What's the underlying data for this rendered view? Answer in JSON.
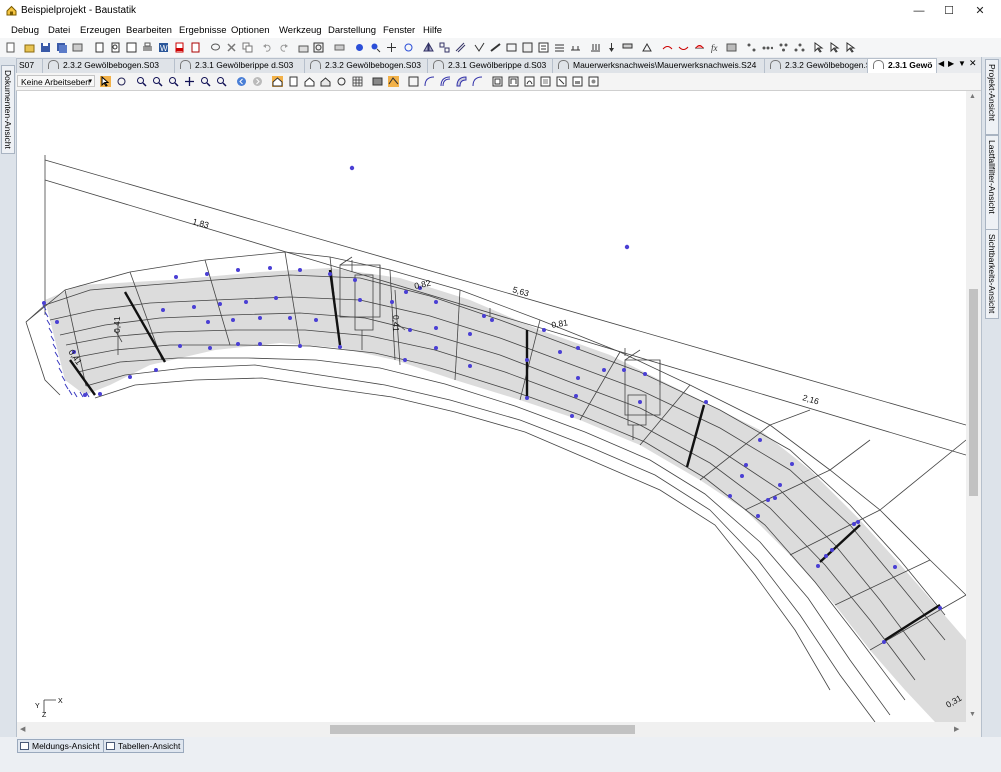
{
  "window": {
    "title": "Beispielprojekt - Baustatik",
    "minimize": "—",
    "maximize": "☐",
    "close": "✕"
  },
  "menu": [
    "Debug",
    "Datei",
    "Erzeugen",
    "Bearbeiten",
    "Ergebnisse",
    "Optionen",
    "Werkzeug",
    "Darstellung",
    "Fenster",
    "Hilfe"
  ],
  "tabs": [
    "S07",
    "2.3.2   Gewölbebogen.S03",
    "2.3.1   Gewölberippe d.S03",
    "2.3.2   Gewölbebogen.S03",
    "2.3.1   Gewölberippe d.S03",
    "Mauerwerksnachweis\\Mauerwerksnachweis.S24",
    "2.3.2   Gewölbebogen.S03",
    "2.3.1   Gewö"
  ],
  "tab_nav": {
    "left": "◀",
    "right": "▶",
    "menu": "▼",
    "close": "✕"
  },
  "view_toolbar": {
    "arbeitsebene_select": "Keine Arbeitseben"
  },
  "side_panels": {
    "left": [
      "Dokumenten-Ansicht"
    ],
    "right": [
      "Projekt-Ansicht",
      "Lastfallfilter-Ansicht",
      "Sichtbarkeits-Ansicht"
    ]
  },
  "drawing": {
    "dimension_labels": [
      "1,83",
      "5,63",
      "2,16",
      "0,82",
      "0,81",
      "0,41",
      "0,41",
      "0,41",
      "0,31"
    ],
    "axes": {
      "x": "X",
      "y": "Y",
      "z": "Z"
    }
  },
  "bottom_tabs": [
    "Meldungs-Ansicht",
    "Tabellen-Ansicht"
  ],
  "colors": {
    "accent": "#f2b148",
    "node": "#4a3fd4",
    "shade": "#dcdcdc"
  }
}
